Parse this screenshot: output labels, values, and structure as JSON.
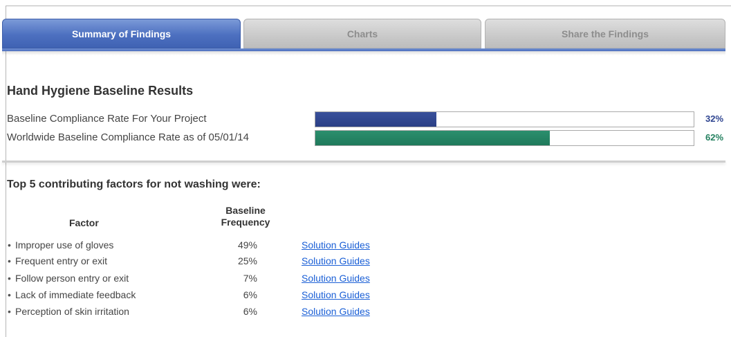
{
  "tabs": [
    {
      "label": "Summary of Findings",
      "active": true
    },
    {
      "label": "Charts",
      "active": false
    },
    {
      "label": "Share the Findings",
      "active": false
    }
  ],
  "results": {
    "title": "Hand Hygiene Baseline Results",
    "rates": [
      {
        "label": "Baseline Compliance Rate For Your Project",
        "percent_label": "32%",
        "value": 32,
        "color": "#2e4490"
      },
      {
        "label": "Worldwide Baseline Compliance Rate as of 05/01/14",
        "percent_label": "62%",
        "value": 62,
        "color": "#23805f"
      }
    ]
  },
  "factors": {
    "title": "Top 5 contributing factors for not washing were:",
    "headers": {
      "factor": "Factor",
      "frequency_line1": "Baseline",
      "frequency_line2": "Frequency"
    },
    "rows": [
      {
        "name": "Improper use of gloves",
        "frequency": "49%",
        "link": "Solution Guides"
      },
      {
        "name": "Frequent entry or exit",
        "frequency": "25%",
        "link": "Solution Guides"
      },
      {
        "name": "Follow person entry or exit",
        "frequency": "7%",
        "link": "Solution Guides"
      },
      {
        "name": "Lack of immediate feedback",
        "frequency": "6%",
        "link": "Solution Guides"
      },
      {
        "name": "Perception of skin irritation",
        "frequency": "6%",
        "link": "Solution Guides"
      }
    ]
  }
}
